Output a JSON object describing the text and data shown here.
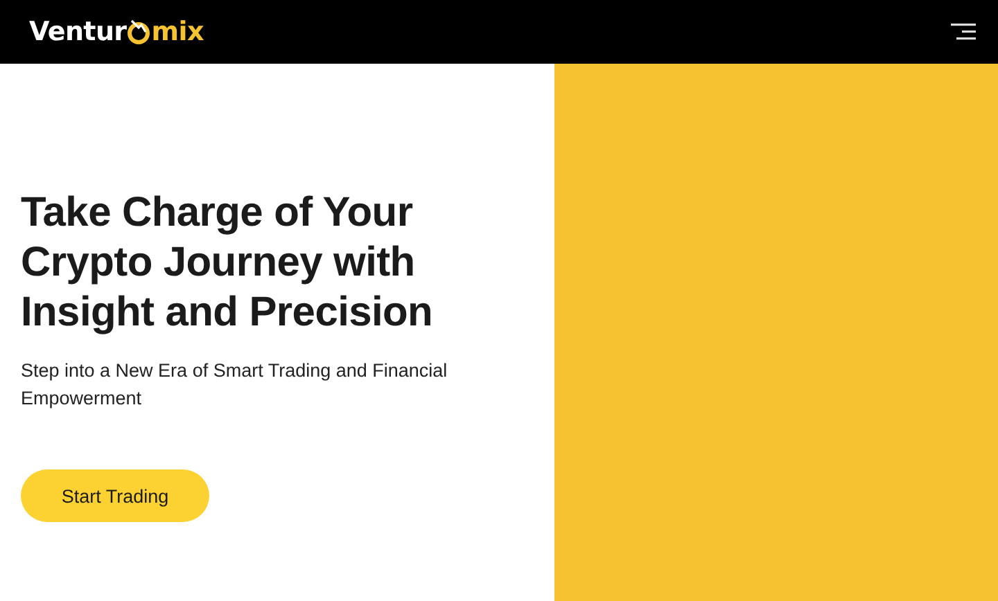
{
  "header": {
    "logo": {
      "lead": "Ventur",
      "tail": "mix"
    }
  },
  "hero": {
    "title": "Take Charge of Your Crypto Journey with Insight and Precision",
    "subtitle": "Step into a New Era of Smart Trading and Financial Empowerment",
    "button": "Start Trading"
  }
}
